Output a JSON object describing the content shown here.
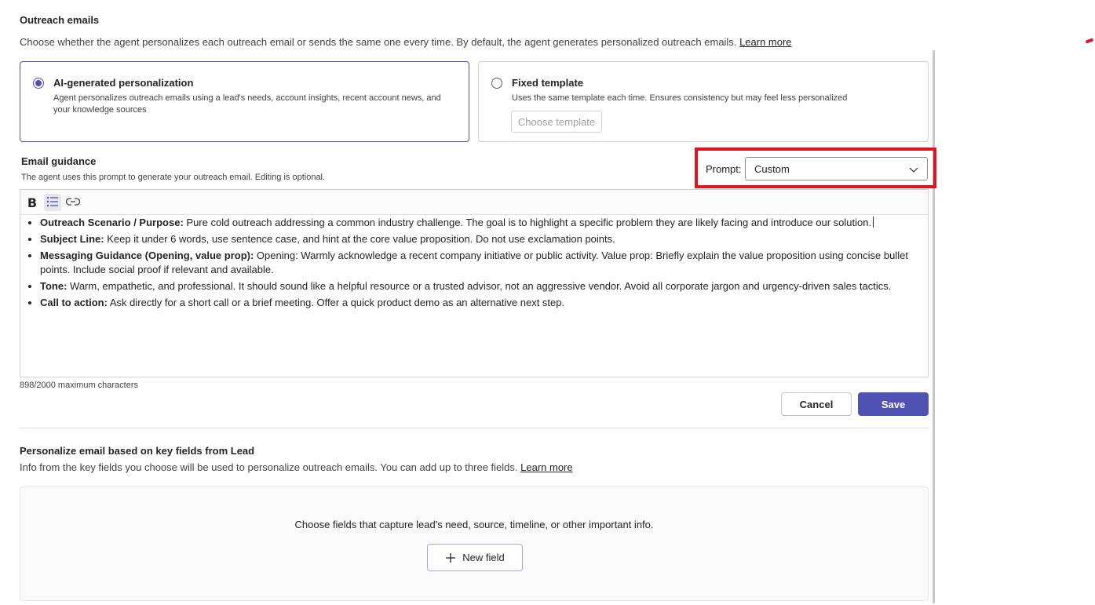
{
  "outreach": {
    "title": "Outreach emails",
    "description": "Choose whether the agent personalizes each outreach email or sends the same one every time. By default, the agent generates personalized outreach emails.",
    "learn_more": "Learn more"
  },
  "options": {
    "ai": {
      "title": "AI-generated personalization",
      "description": "Agent personalizes outreach emails using a lead's needs, account insights, recent account news, and your knowledge sources",
      "selected": true
    },
    "fixed": {
      "title": "Fixed template",
      "description": "Uses the same template each time. Ensures consistency but may feel less personalized",
      "button": "Choose template",
      "selected": false
    }
  },
  "guidance": {
    "title": "Email guidance",
    "description": "The agent uses this prompt to generate your outreach email. Editing is optional.",
    "prompt_label": "Prompt:",
    "prompt_value": "Custom",
    "toolbar": {
      "bold": "B"
    },
    "items": [
      {
        "label": "Outreach Scenario / Purpose:",
        "text": " Pure cold outreach addressing a common industry challenge. The goal is to highlight a specific problem they are likely facing and introduce our solution."
      },
      {
        "label": "Subject Line:",
        "text": " Keep it under 6 words, use sentence case, and hint at the core value proposition. Do not use exclamation points."
      },
      {
        "label": "Messaging Guidance (Opening, value prop):",
        "text": " Opening: Warmly acknowledge a recent company initiative or public activity. Value prop: Briefly explain the value proposition using concise bullet points. Include social proof if relevant and available."
      },
      {
        "label": "Tone:",
        "text": " Warm, empathetic, and professional. It should sound like a helpful resource or a trusted advisor, not an aggressive vendor. Avoid all corporate jargon and urgency-driven sales tactics."
      },
      {
        "label": "Call to action:",
        "text": " Ask directly for a short call or a brief meeting. Offer a quick product demo as an alternative next step."
      }
    ],
    "char_count": "898/2000 maximum characters",
    "cancel": "Cancel",
    "save": "Save"
  },
  "key_fields": {
    "title": "Personalize email based on key fields from Lead",
    "description": "Info from the key fields you choose will be used to personalize outreach emails. You can add up to three fields.",
    "learn_more": "Learn more",
    "empty_text": "Choose fields that capture lead's need, source, timeline, or other important info.",
    "new_field": "New field"
  },
  "colors": {
    "accent": "#4f52b2",
    "highlight": "#e0141e"
  }
}
